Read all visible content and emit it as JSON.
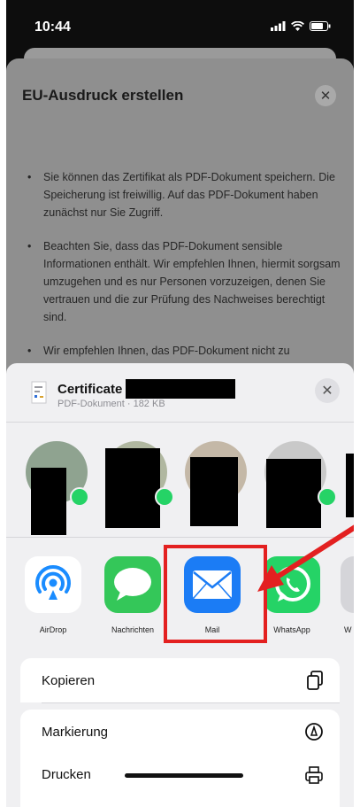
{
  "status_bar": {
    "time": "10:44"
  },
  "dialog": {
    "title": "EU-Ausdruck erstellen",
    "close_glyph": "✕",
    "bullets": [
      "Sie können das Zertifikat als PDF-Dokument speichern. Die Speicherung ist freiwillig. Auf das PDF-Dokument haben zunächst nur Sie Zugriff.",
      "Beachten Sie, dass das PDF-Dokument sensible Informationen enthält. Wir empfehlen Ihnen, hiermit sorgsam umzugehen und es nur Personen vorzuzeigen, denen Sie vertrauen und die zur Prüfung des Nachweises berechtigt sind.",
      "Wir empfehlen Ihnen, das PDF-Dokument nicht zu"
    ]
  },
  "share_sheet": {
    "file_name": "Certificate",
    "file_meta": "PDF-Dokument · 182 KB",
    "close_glyph": "✕",
    "apps": [
      {
        "label": "AirDrop",
        "icon": "airdrop-icon",
        "color": "#1a8cff"
      },
      {
        "label": "Nachrichten",
        "icon": "messages-icon",
        "color": "#34c759"
      },
      {
        "label": "Mail",
        "icon": "mail-icon",
        "color": "#1b7cf5"
      },
      {
        "label": "WhatsApp",
        "icon": "whatsapp-icon",
        "color": "#25d366"
      },
      {
        "label": "W",
        "icon": "app-icon",
        "color": "#cccccc"
      }
    ],
    "actions": [
      {
        "label": "Kopieren",
        "icon": "copy-icon"
      },
      {
        "label": "Markierung",
        "icon": "markup-icon"
      },
      {
        "label": "Drucken",
        "icon": "print-icon"
      }
    ]
  },
  "annotation": {
    "highlight_color": "#e32020",
    "highlight_target": "Mail"
  }
}
